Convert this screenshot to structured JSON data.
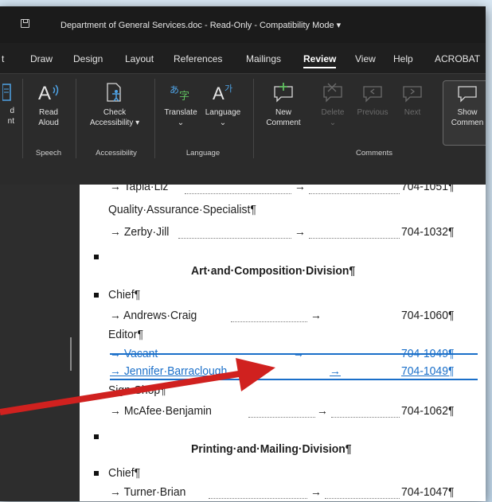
{
  "titlebar": {
    "doc_title": "Department of General Services.doc  -  Read-Only  -  Compatibility Mode  ▾"
  },
  "tabs": [
    "t",
    "Draw",
    "Design",
    "Layout",
    "References",
    "Mailings",
    "Review",
    "View",
    "Help",
    "ACROBAT"
  ],
  "active_tab": "Review",
  "ribbon": {
    "read_aloud": "Read\nAloud",
    "read_label_1": "Read",
    "read_label_2": "Aloud",
    "partial_left_1": "d",
    "partial_left_2": "nt",
    "check_1": "Check",
    "check_2": "Accessibility ▾",
    "translate": "Translate",
    "language": "Language",
    "new_1": "New",
    "new_2": "Comment",
    "delete": "Delete",
    "previous": "Previous",
    "next": "Next",
    "show_1": "Show",
    "show_2": "Commen",
    "group_speech": "Speech",
    "group_accessibility": "Accessibility",
    "group_language": "Language",
    "group_comments": "Comments"
  },
  "document": {
    "line1_name": "→  Tapia·Liz",
    "line1_tab": "→",
    "line1_phone": "704-1051¶",
    "line2": "Quality·Assurance·Specialist¶",
    "line3_name": "→  Zerby·Jill",
    "line3_tab": "→",
    "line3_phone": "704-1032¶",
    "heading1": "Art·and·Composition·Division¶",
    "chief1": "Chief¶",
    "line5_name": "→  Andrews·Craig",
    "line5_tab": "→",
    "line5_phone": "704-1060¶",
    "editor": "Editor¶",
    "vacant_name": "→  Vacant",
    "vacant_tab": "→",
    "vacant_phone": "704-1049¶",
    "jennifer_name": "→  Jennifer·Barraclough",
    "jennifer_tab": "→",
    "jennifer_phone": "704-1049¶",
    "sign_shop": "Sign·Shop¶",
    "line9_name": "→  McAfee·Benjamin",
    "line9_tab": "→",
    "line9_phone": "704-1062¶",
    "heading2": "Printing·and·Mailing·Division¶",
    "chief2": "Chief¶",
    "line11_name": "→  Turner·Brian",
    "line11_tab": "→",
    "line11_phone": "704-1047¶"
  },
  "colors": {
    "arrow": "#d0211f",
    "tracked_change": "#1a6fc9"
  }
}
